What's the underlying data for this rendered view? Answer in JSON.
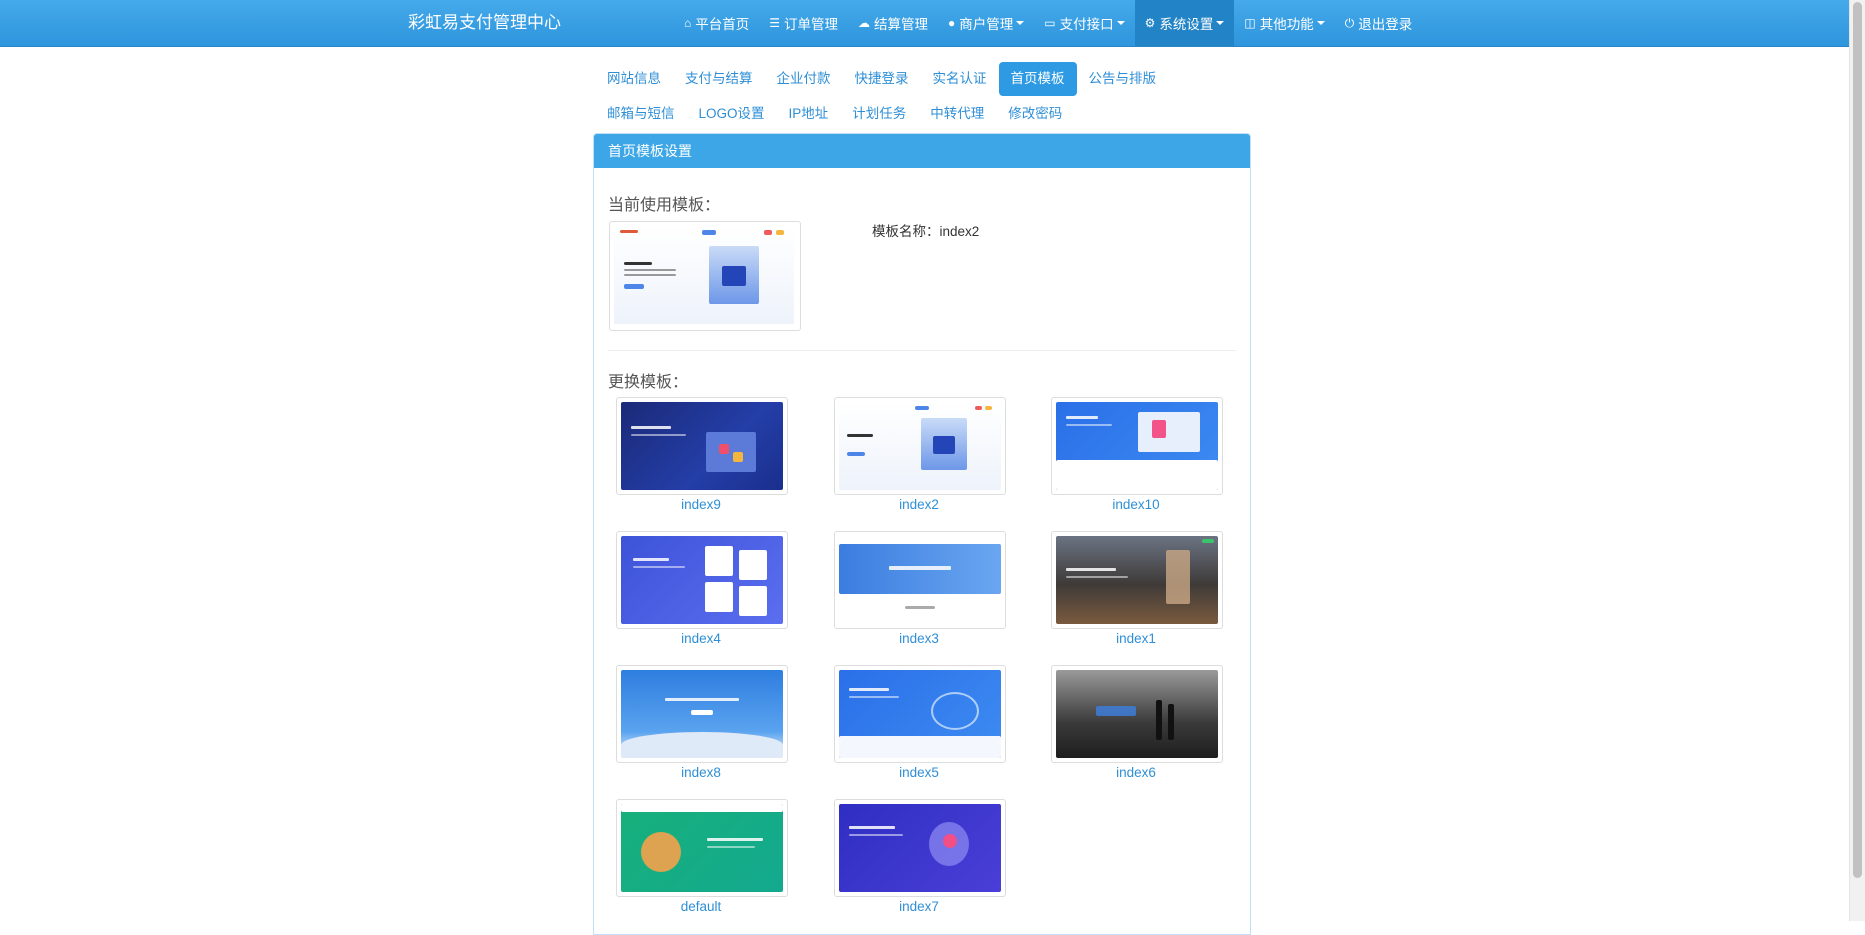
{
  "navbar": {
    "brand": "彩虹易支付管理中心",
    "items": [
      {
        "label": "平台首页",
        "icon": "home-icon"
      },
      {
        "label": "订单管理",
        "icon": "list-icon"
      },
      {
        "label": "结算管理",
        "icon": "cloud-icon"
      },
      {
        "label": "商户管理",
        "icon": "user-icon",
        "dropdown": true
      },
      {
        "label": "支付接口",
        "icon": "card-icon",
        "dropdown": true
      },
      {
        "label": "系统设置",
        "icon": "gear-icon",
        "dropdown": true,
        "active": true
      },
      {
        "label": "其他功能",
        "icon": "cube-icon",
        "dropdown": true
      },
      {
        "label": "退出登录",
        "icon": "power-icon"
      }
    ]
  },
  "tabs": {
    "row1": [
      "网站信息",
      "支付与结算",
      "企业付款",
      "快捷登录",
      "实名认证",
      "首页模板",
      "公告与排版"
    ],
    "row2": [
      "邮箱与短信",
      "LOGO设置",
      "IP地址",
      "计划任务",
      "中转代理",
      "修改密码"
    ],
    "active": "首页模板"
  },
  "panel": {
    "title": "首页模板设置",
    "current_title": "当前使用模板：",
    "template_name_label": "模板名称：",
    "template_name_value": "index2",
    "change_title": "更换模板：",
    "templates": [
      "index9",
      "index2",
      "index10",
      "index4",
      "index3",
      "index1",
      "index8",
      "index5",
      "index6",
      "default",
      "index7"
    ]
  },
  "colors": {
    "navbar": "#3a9fe4",
    "accent": "#2d9ae3",
    "link": "#2f8fd6",
    "panel_header": "#3ca6e6"
  }
}
